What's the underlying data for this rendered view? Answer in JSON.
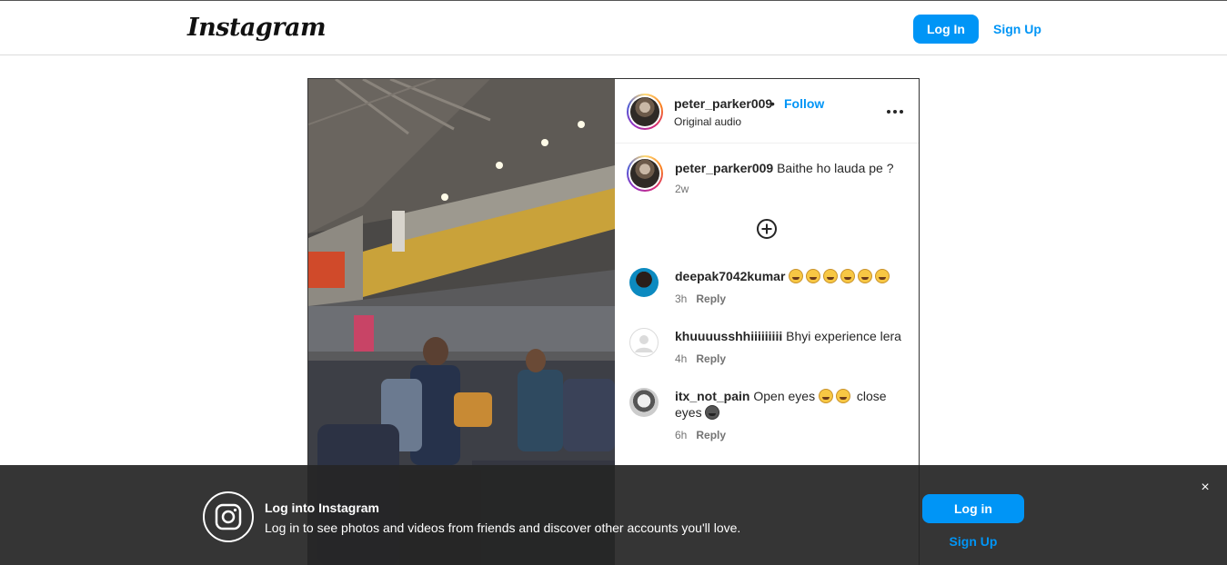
{
  "topbar": {
    "logo": "Instagram",
    "login_label": "Log In",
    "signup_label": "Sign Up"
  },
  "post": {
    "header": {
      "username": "peter_parker009",
      "separator": "•",
      "follow_label": "Follow",
      "audio": "Original audio",
      "more_label": "•••"
    },
    "caption": {
      "username": "peter_parker009",
      "text": "Baithe ho lauda pe ?",
      "time": "2w"
    },
    "comments": [
      {
        "username": "deepak7042kumar",
        "text": "",
        "emoji_count": 6,
        "time": "3h",
        "reply": "Reply"
      },
      {
        "username": "khuuuusshhiiiiiiiii",
        "text": "Bhyi experience lera",
        "time": "4h",
        "reply": "Reply"
      },
      {
        "username": "itx_not_pain",
        "text_a": "Open eyes",
        "text_b": "close",
        "text_c": "eyes",
        "time": "6h",
        "reply": "Reply"
      }
    ]
  },
  "banner": {
    "title": "Log into Instagram",
    "subtitle": "Log in to see photos and videos from friends and discover other accounts you'll love.",
    "login_label": "Log in",
    "signup_label": "Sign Up",
    "close_label": "×"
  },
  "colors": {
    "accent": "#0095f6",
    "banner_bg": "#262626"
  }
}
